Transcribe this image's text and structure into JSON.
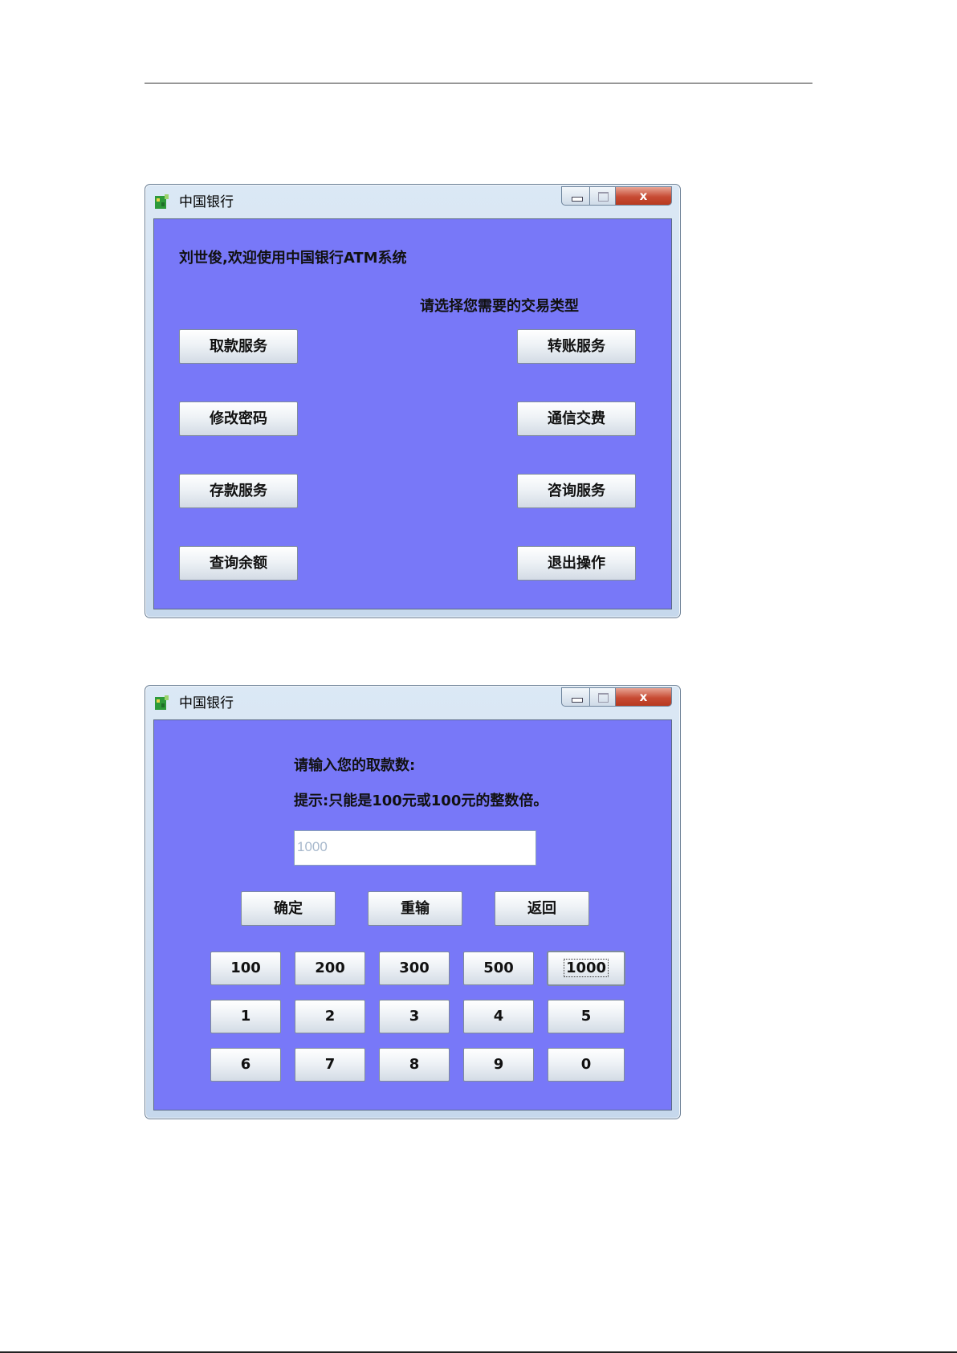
{
  "window1": {
    "title": "中国银行",
    "welcome": "刘世俊,欢迎使用中国银行ATM系统",
    "prompt": "请选择您需要的交易类型",
    "buttons_left": [
      "取款服务",
      "修改密码",
      "存款服务",
      "查询余额"
    ],
    "buttons_right": [
      "转账服务",
      "通信交费",
      "咨询服务",
      "退出操作"
    ]
  },
  "window2": {
    "title": "中国银行",
    "prompt": "请输入您的取款数:",
    "hint": "提示:只能是100元或100元的整数倍。",
    "amount_placeholder": "1000",
    "action_buttons": [
      "确定",
      "重输",
      "返回"
    ],
    "keypad": [
      [
        "100",
        "200",
        "300",
        "500",
        "1000"
      ],
      [
        "1",
        "2",
        "3",
        "4",
        "5"
      ],
      [
        "6",
        "7",
        "8",
        "9",
        "0"
      ]
    ]
  },
  "controls": {
    "close": "x"
  },
  "colors": {
    "client_bg": "#7878f8",
    "close_button": "#c74b34"
  }
}
